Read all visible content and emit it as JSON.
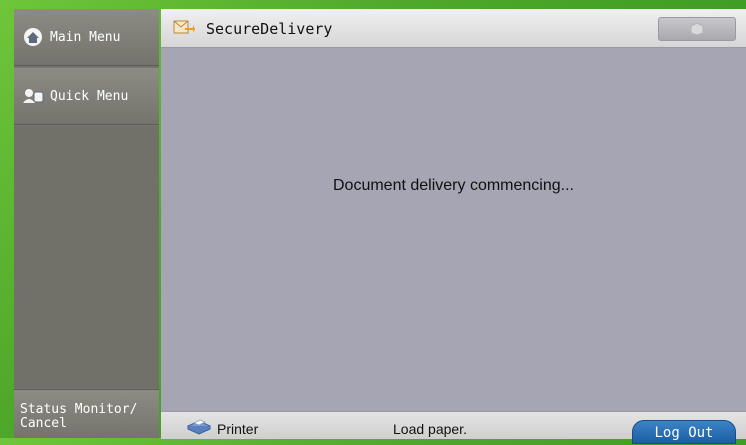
{
  "sidebar": {
    "main_menu": "Main Menu",
    "quick_menu": "Quick Menu",
    "status_monitor": "Status Monitor/\nCancel"
  },
  "window": {
    "title": "SecureDelivery",
    "message": "Document delivery commencing..."
  },
  "statusbar": {
    "device": "Printer",
    "status_text": "Load paper.",
    "logout": "Log Out"
  },
  "icons": {
    "main_menu": "home-icon",
    "quick_menu": "users-icon",
    "app": "secure-delivery-icon",
    "printer": "printer-icon"
  },
  "colors": {
    "background": "#4fa82a",
    "sidebar": "#76766f",
    "content": "#a5a5b3",
    "logout": "#2a6fb6"
  }
}
